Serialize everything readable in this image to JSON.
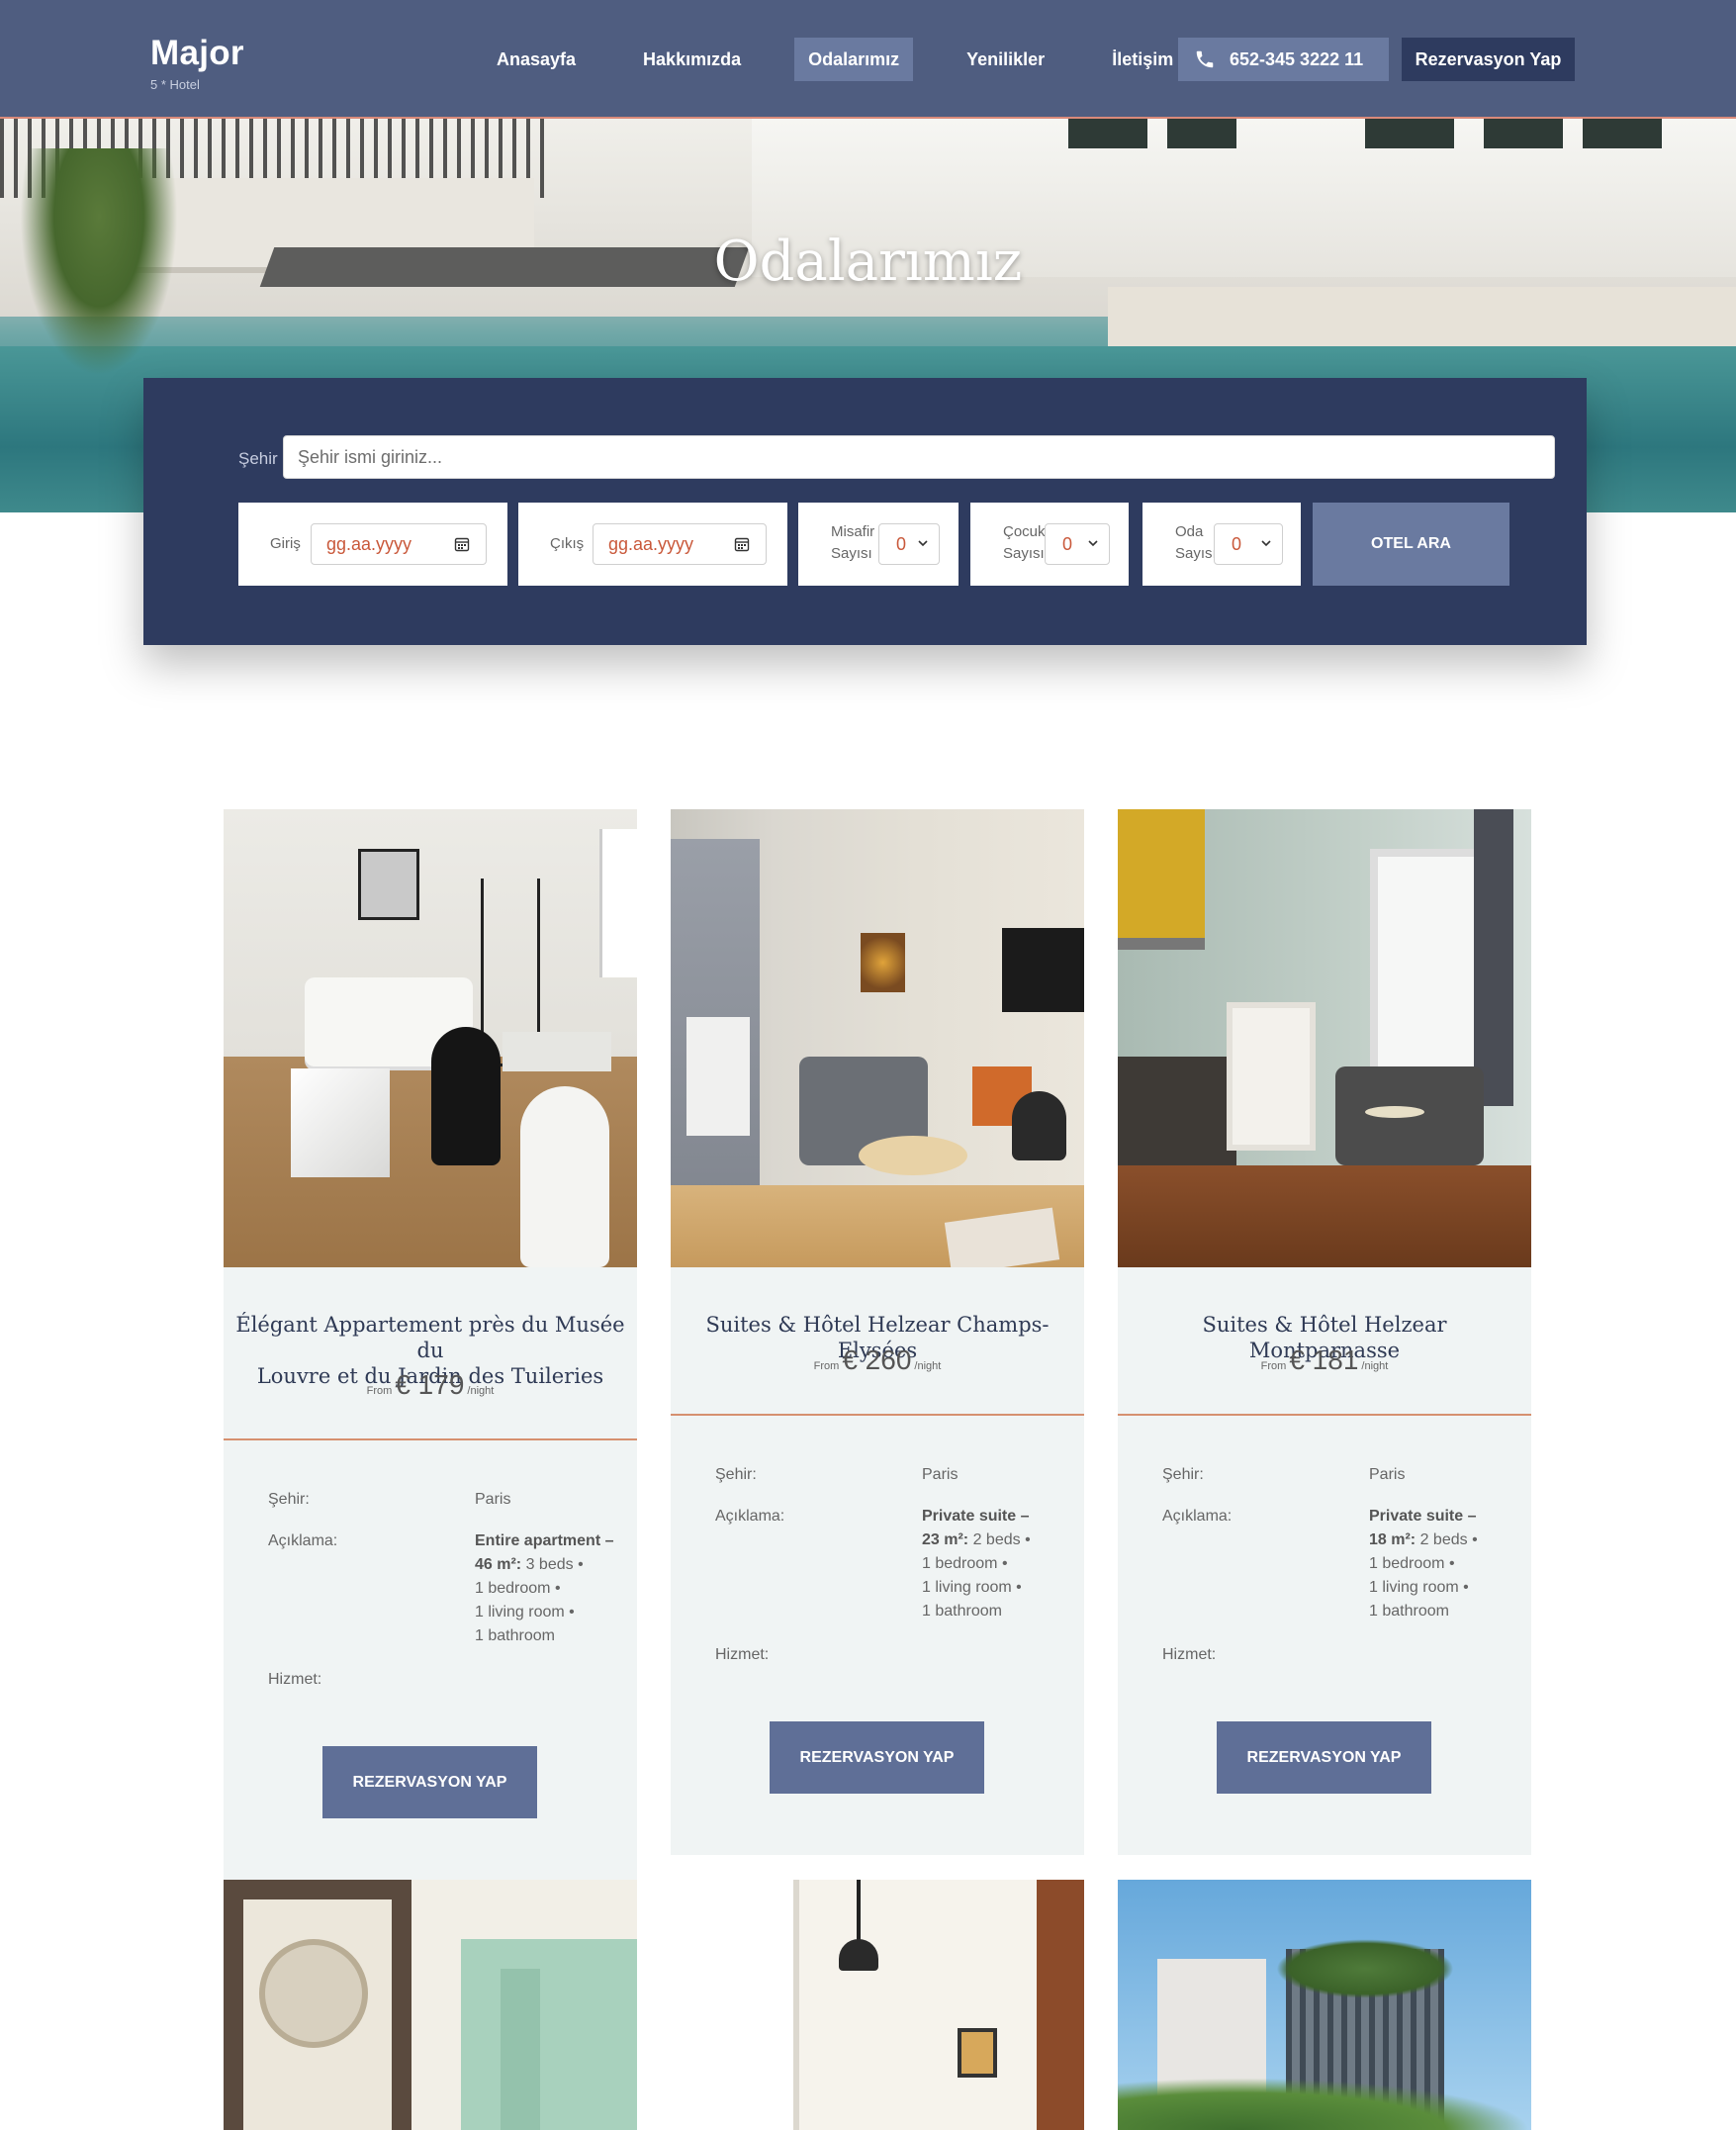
{
  "header": {
    "brand_name": "Major",
    "brand_sub": "5 * Hotel",
    "nav": [
      "Anasayfa",
      "Hakkımızda",
      "Odalarımız",
      "Yenilikler",
      "İletişim"
    ],
    "active_nav": "Odalarımız",
    "phone": "652-345 3222 11",
    "reserve_label": "Rezervasyon Yap"
  },
  "hero": {
    "title": "Odalarımız"
  },
  "search": {
    "city_label": "Şehir",
    "city_placeholder": "Şehir ismi giriniz...",
    "checkin_label": "Giriş",
    "checkin_placeholder": "gg.aa.yyyy",
    "checkout_label": "Çıkış",
    "checkout_placeholder": "gg.aa.yyyy",
    "guests_label_1": "Misafir",
    "guests_label_2": "Sayısı",
    "guests_value": "0",
    "children_label_1": "Çocuk",
    "children_label_2": "Sayısı",
    "children_value": "0",
    "rooms_label_1": "Oda",
    "rooms_label_2": "Sayısı",
    "rooms_value": "0",
    "button_label": "OTEL ARA"
  },
  "labels": {
    "city": "Şehir:",
    "description": "Açıklama:",
    "service": "Hizmet:",
    "from": "From",
    "per_night": "/night",
    "book": "REZERVASYON YAP"
  },
  "rooms": [
    {
      "title_line1": "Élégant Appartement près du Musée du",
      "title_line2": "Louvre et du Jardin des Tuileries",
      "price": "€ 179",
      "city": "Paris",
      "desc_bold_1": "Entire apartment –",
      "desc_bold_2": "46 m²:",
      "desc_after": "3 beds •",
      "desc_3": "1 bedroom •",
      "desc_4": "1 living room •",
      "desc_5": "1 bathroom"
    },
    {
      "title_line1": "Suites & Hôtel Helzear Champs-Elysées",
      "price": "€ 260",
      "city": "Paris",
      "desc_bold_1": "Private suite –",
      "desc_bold_2": "23 m²:",
      "desc_after": "2 beds •",
      "desc_3": "1 bedroom •",
      "desc_4": "1 living room •",
      "desc_5": "1 bathroom"
    },
    {
      "title_line1": "Suites & Hôtel Helzear Montparnasse",
      "price": "€ 181",
      "city": "Paris",
      "desc_bold_1": "Private suite –",
      "desc_bold_2": "18 m²:",
      "desc_after": "2 beds •",
      "desc_3": "1 bedroom •",
      "desc_4": "1 living room •",
      "desc_5": "1 bathroom"
    }
  ]
}
